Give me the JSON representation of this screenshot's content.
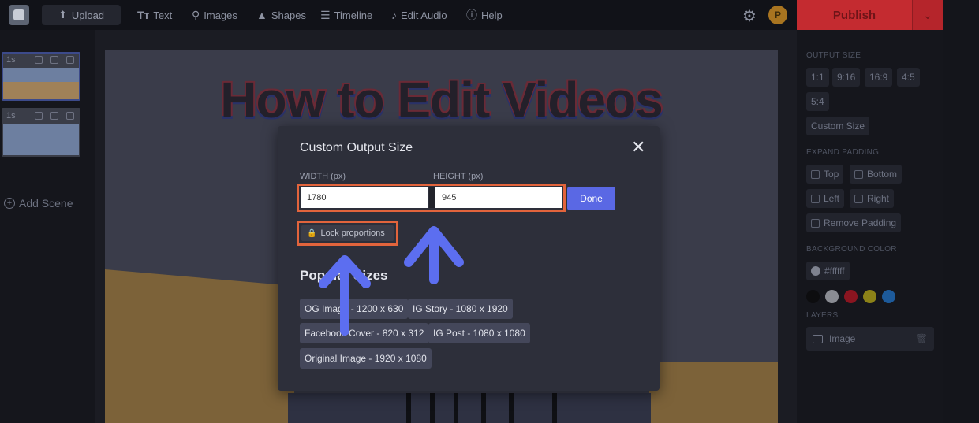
{
  "topbar": {
    "upload_label": "Upload",
    "text_label": "Text",
    "images_label": "Images",
    "shapes_label": "Shapes",
    "timeline_label": "Timeline",
    "edit_audio_label": "Edit Audio",
    "help_label": "Help",
    "avatar_initial": "P",
    "publish_label": "Publish"
  },
  "scenes": {
    "items": [
      {
        "duration": "1s"
      },
      {
        "duration": "1s"
      }
    ],
    "add_label": "Add Scene"
  },
  "canvas": {
    "title": "How to Edit Videos"
  },
  "properties": {
    "output_size_label": "OUTPUT SIZE",
    "ratios": [
      "1:1",
      "9:16",
      "16:9",
      "4:5",
      "5:4"
    ],
    "custom_size_label": "Custom Size",
    "expand_padding_label": "EXPAND PADDING",
    "padding": {
      "top": "Top",
      "bottom": "Bottom",
      "left": "Left",
      "right": "Right",
      "remove": "Remove Padding"
    },
    "background_color_label": "BACKGROUND COLOR",
    "background_value": "#ffffff",
    "swatches": [
      "#0d0d0f",
      "#8a8c93",
      "#8a1520",
      "#8c8218",
      "#1d5a9a"
    ],
    "layers_label": "LAYERS",
    "layer_name": "Image"
  },
  "modal": {
    "title": "Custom Output Size",
    "width_label": "WIDTH (px)",
    "height_label": "HEIGHT (px)",
    "width_value": "1780",
    "height_value": "945",
    "done_label": "Done",
    "lock_label": "Lock proportions",
    "popular_title": "Popular Sizes",
    "presets": [
      "OG Image - 1200 x 630",
      "IG Story - 1080 x 1920",
      "Facebook Cover - 820 x 312",
      "IG Post - 1080 x 1080",
      "Original Image - 1920 x 1080"
    ]
  },
  "colors": {
    "accent": "#5a68e4",
    "highlight": "#e2643c",
    "publish": "#c42b30",
    "arrow": "#5c6ef0"
  }
}
